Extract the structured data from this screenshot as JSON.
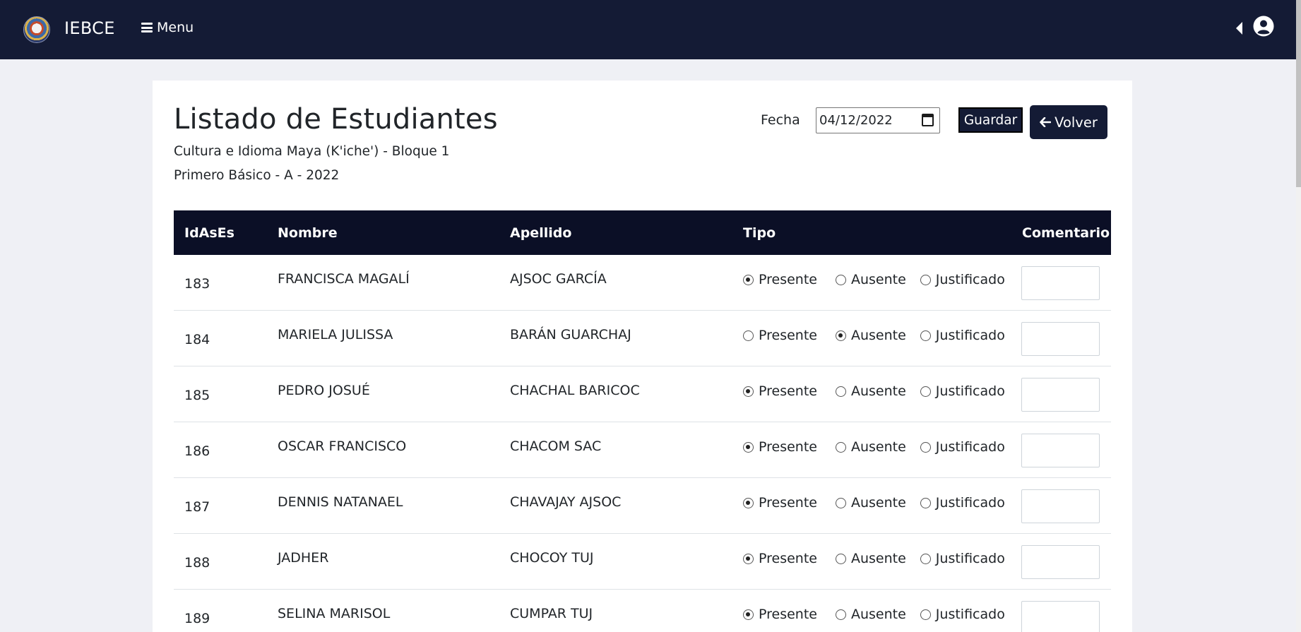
{
  "navbar": {
    "brand": "IEBCE",
    "menu_label": "Menu"
  },
  "page": {
    "title": "Listado de Estudiantes",
    "course": "Cultura e Idioma Maya (K'iche') - Bloque 1",
    "group": "Primero Básico - A - 2022",
    "date_label": "Fecha",
    "date_value": "04/12/2022",
    "save_label": "Guardar",
    "back_label": "Volver"
  },
  "table": {
    "headers": [
      "IdAsEs",
      "Nombre",
      "Apellido",
      "Tipo",
      "Comentario"
    ],
    "options": [
      "Presente",
      "Ausente",
      "Justificado"
    ],
    "rows": [
      {
        "id": "183",
        "nombre": "FRANCISCA MAGALÍ",
        "apellido": "AJSOC GARCÍA",
        "tipo": "Presente",
        "comentario": ""
      },
      {
        "id": "184",
        "nombre": "MARIELA JULISSA",
        "apellido": "BARÁN GUARCHAJ",
        "tipo": "Ausente",
        "comentario": ""
      },
      {
        "id": "185",
        "nombre": "PEDRO JOSUÉ",
        "apellido": "CHACHAL BARICOC",
        "tipo": "Presente",
        "comentario": ""
      },
      {
        "id": "186",
        "nombre": "OSCAR FRANCISCO",
        "apellido": "CHACOM SAC",
        "tipo": "Presente",
        "comentario": ""
      },
      {
        "id": "187",
        "nombre": "DENNIS NATANAEL",
        "apellido": "CHAVAJAY AJSOC",
        "tipo": "Presente",
        "comentario": ""
      },
      {
        "id": "188",
        "nombre": "JADHER",
        "apellido": "CHOCOY TUJ",
        "tipo": "Presente",
        "comentario": ""
      },
      {
        "id": "189",
        "nombre": "SELINA MARISOL",
        "apellido": "CUMPAR TUJ",
        "tipo": "Presente",
        "comentario": ""
      }
    ]
  },
  "colors": {
    "navbar": "#141b35",
    "table_header": "#0b0f26",
    "background": "#eff0f5"
  }
}
